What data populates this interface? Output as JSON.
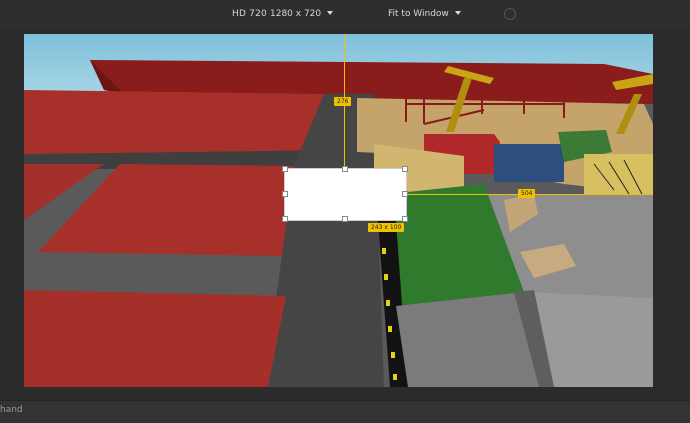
{
  "toolbar": {
    "resolution_preset": "HD 720",
    "resolution_size": "1280 x 720",
    "zoom_mode": "Fit to Window"
  },
  "viewport": {
    "guide_vertical_label": "276",
    "guide_horizontal_label": "504",
    "selection_size_label": "243 x 100"
  },
  "statusbar": {
    "command_label": "hand"
  }
}
